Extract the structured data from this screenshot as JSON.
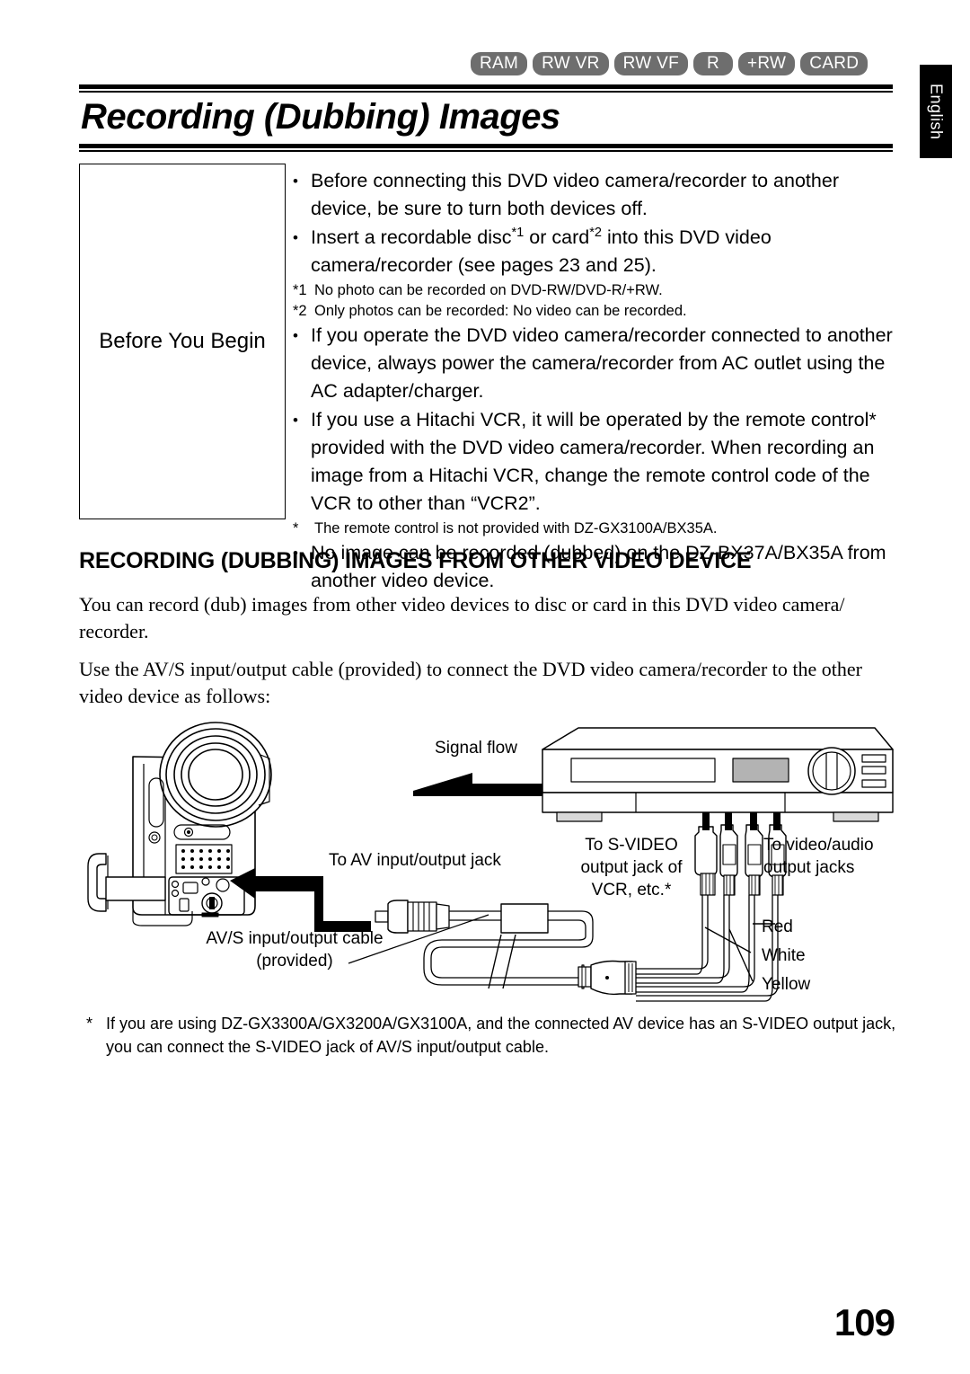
{
  "header": {
    "badges": [
      {
        "label": "RAM"
      },
      {
        "label": "RW VR"
      },
      {
        "label": "RW VF"
      },
      {
        "label": "R"
      },
      {
        "label": "+RW"
      },
      {
        "label": "CARD"
      }
    ],
    "language_tab": "English",
    "title": "Recording (Dubbing) Images"
  },
  "before_you_begin": {
    "box_label": "Before You Begin",
    "notes": [
      "Before connecting this DVD video camera/recorder to another device, be sure to turn both devices off.",
      "Insert a recordable disc*1 or card*2 into this DVD video camera/recorder (see pages 23 and 25).",
      "If you operate the DVD video camera/recorder connected to another device, always power the camera/recorder from AC outlet using the AC adapter/charger.",
      "If you use a Hitachi VCR, it will be operated by the remote control* provided with the DVD video camera/recorder. When recording an image from a Hitachi VCR, change the remote control code of the VCR to other than “VCR2”.",
      "No image can be recorded (dubbed) on the DZ-BX37A/BX35A from another video device."
    ],
    "note2_parts": {
      "a": "Insert a recordable disc",
      "sup1": "*1",
      "b": " or card",
      "sup2": "*2",
      "c": " into this DVD video camera/recorder (see pages 23 and 25)."
    },
    "footnotes": [
      {
        "marker": "*1",
        "text": "No photo can be recorded on DVD-RW/DVD-R/+RW."
      },
      {
        "marker": "*2",
        "text": "Only photos can be recorded: No video can be recorded."
      },
      {
        "marker": "*",
        "text": "The remote control is not provided with DZ-GX3100A/BX35A."
      }
    ]
  },
  "section": {
    "heading": "RECORDING (DUBBING) IMAGES FROM OTHER VIDEO DEVICE",
    "paragraph_1": "You can record (dub) images from other video devices to disc or card in this DVD video camera/ recorder.",
    "paragraph_2": "Use the AV/S  input/output cable (provided) to connect the DVD video camera/recorder to the other video device as follows:"
  },
  "figure": {
    "signal_flow": "Signal flow",
    "to_av_jack": "To AV input/output jack",
    "cable_label": "AV/S input/output cable\n(provided)",
    "to_svideo": "To S-VIDEO\noutput jack of\nVCR, etc.*",
    "to_video_audio": "To video/audio\noutput jacks",
    "wire_red": "Red",
    "wire_white": "White",
    "wire_yellow": "Yellow"
  },
  "bottom_footnote": {
    "marker": "*",
    "text": "If you are using DZ-GX3300A/GX3200A/GX3100A, and the connected AV device has an S-VIDEO output jack, you can connect the S-VIDEO jack of AV/S input/output cable."
  },
  "page_number": "109",
  "colors": {
    "badge_background": "#6e6e6e",
    "badge_text": "#ffffff",
    "tab_background": "#000000",
    "display_panel": "#b3b3b3",
    "device_shade": "#d9d9d9"
  }
}
